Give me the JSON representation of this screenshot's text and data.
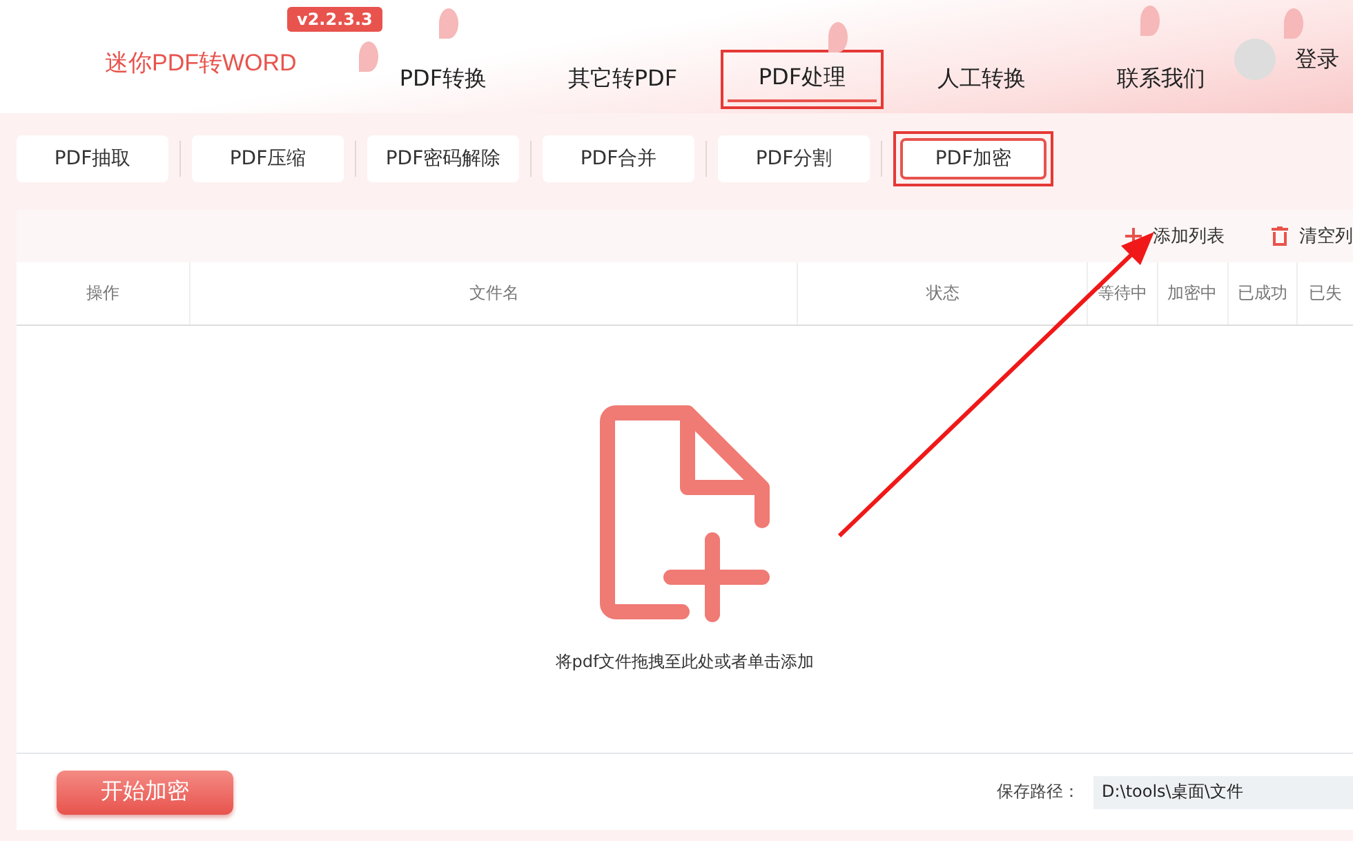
{
  "app": {
    "name": "迷你PDF转WORD",
    "version": "v2.2.3.3"
  },
  "nav": [
    {
      "label": "PDF转换",
      "selected": false
    },
    {
      "label": "其它转PDF",
      "selected": false
    },
    {
      "label": "PDF处理",
      "selected": true
    },
    {
      "label": "人工转换",
      "selected": false
    },
    {
      "label": "联系我们",
      "selected": false
    }
  ],
  "user": {
    "label": "登录"
  },
  "tools": [
    {
      "label": "PDF抽取",
      "selected": false
    },
    {
      "label": "PDF压缩",
      "selected": false
    },
    {
      "label": "PDF密码解除",
      "selected": false
    },
    {
      "label": "PDF合并",
      "selected": false
    },
    {
      "label": "PDF分割",
      "selected": false
    },
    {
      "label": "PDF加密",
      "selected": true
    }
  ],
  "list_actions": [
    {
      "kind": "add",
      "label": "添加列表"
    },
    {
      "kind": "clear",
      "label": "清空列"
    }
  ],
  "table": {
    "columns": [
      "操作",
      "文件名",
      "状态",
      "等待中",
      "加密中",
      "已成功",
      "已失"
    ]
  },
  "empty_state": {
    "hint": "将pdf文件拖拽至此处或者单击添加"
  },
  "start_button": "开始加密",
  "save_path": {
    "label": "保存路径：",
    "value": "D:\\tools\\桌面\\文件"
  }
}
